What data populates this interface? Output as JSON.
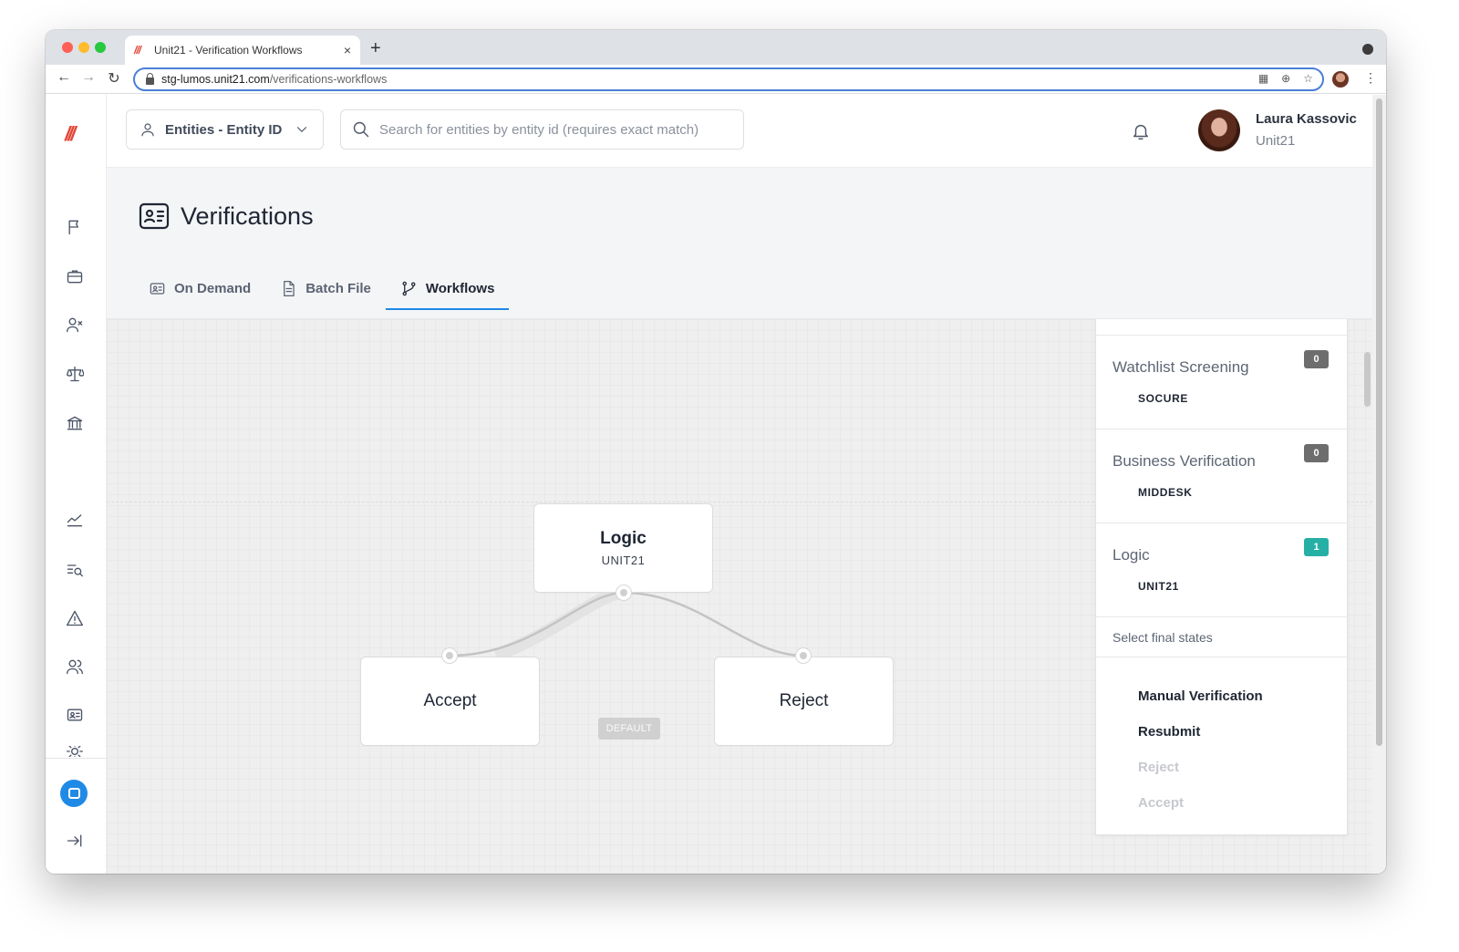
{
  "browser": {
    "tab_title": "Unit21 - Verification Workflows",
    "tab_close": "×",
    "new_tab": "+",
    "url_host": "stg-lumos.unit21.com",
    "url_path": "/verifications-workflows"
  },
  "app": {
    "logo": "///",
    "entity_select": {
      "label": "Entities - Entity ID"
    },
    "search": {
      "placeholder": "Search for entities by entity id (requires exact match)",
      "value": ""
    },
    "user": {
      "name": "Laura Kassovic",
      "org": "Unit21"
    },
    "sidebar_icons": [
      "flag-icon",
      "briefcase-icon",
      "user-x-icon",
      "scale-icon",
      "bank-icon",
      "trend-icon",
      "search-list-icon",
      "alert-triangle-icon",
      "users-icon",
      "id-card-icon",
      "settings-icon",
      "chat-icon",
      "collapse-icon"
    ]
  },
  "page": {
    "title": "Verifications",
    "tabs": [
      {
        "label": "On Demand",
        "icon": "id-card-icon",
        "active": false
      },
      {
        "label": "Batch File",
        "icon": "document-icon",
        "active": false
      },
      {
        "label": "Workflows",
        "icon": "git-branch-icon",
        "active": true
      }
    ]
  },
  "workflow": {
    "nodes": {
      "logic": {
        "title": "Logic",
        "subtitle": "UNIT21"
      },
      "accept": {
        "title": "Accept"
      },
      "reject": {
        "title": "Reject"
      }
    },
    "edge_label": "DEFAULT"
  },
  "panel": {
    "items": [
      {
        "title": "Watchlist Screening",
        "count": "0",
        "vendor": "SOCURE"
      },
      {
        "title": "Business Verification",
        "count": "0",
        "vendor": "MIDDESK"
      },
      {
        "title": "Logic",
        "count": "1",
        "vendor": "UNIT21"
      }
    ],
    "final_states_label": "Select final states",
    "final_states": [
      {
        "label": "Manual Verification",
        "enabled": true
      },
      {
        "label": "Resubmit",
        "enabled": true
      },
      {
        "label": "Reject",
        "enabled": false
      },
      {
        "label": "Accept",
        "enabled": false
      }
    ]
  },
  "colors": {
    "accent": "#1f8ae6",
    "brand": "#e2463a",
    "badge_gray": "#6d6d6d",
    "badge_teal": "#26b0a5"
  }
}
